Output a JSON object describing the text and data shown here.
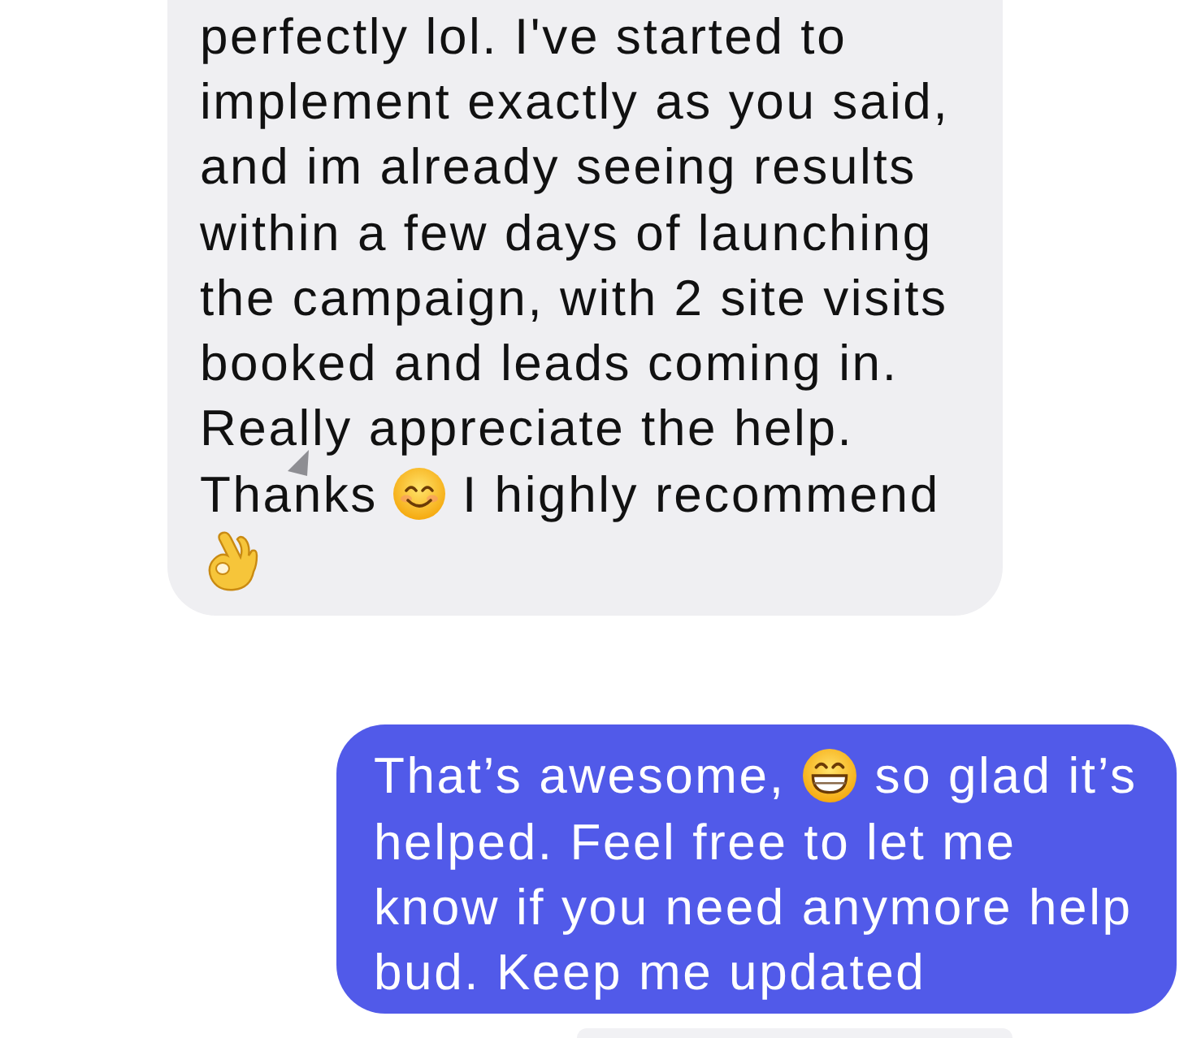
{
  "conversation": {
    "messages": [
      {
        "kind": "received",
        "lines": [
          [
            {
              "kind": "text",
              "text": "perfectly lol. I've started to"
            }
          ],
          [
            {
              "kind": "text",
              "text": "implement exactly as you said,"
            }
          ],
          [
            {
              "kind": "text",
              "text": "and im already seeing results"
            }
          ],
          [
            {
              "kind": "text",
              "text": "within a few days of launching"
            }
          ],
          [
            {
              "kind": "text",
              "text": "the campaign, with 2 site visits"
            }
          ],
          [
            {
              "kind": "text",
              "text": "booked and leads coming in."
            }
          ],
          [
            {
              "kind": "text",
              "text": "Really appreciate the help."
            }
          ],
          [
            {
              "kind": "text",
              "text": "Thanks"
            },
            {
              "kind": "smiling-face"
            },
            {
              "kind": "text",
              "text": "I highly recommend"
            }
          ],
          [
            {
              "kind": "ok-hand"
            }
          ]
        ]
      },
      {
        "kind": "sent",
        "lines": [
          [
            {
              "kind": "text",
              "text": "That’s awesome,"
            },
            {
              "kind": "grinning-face"
            },
            {
              "kind": "text",
              "text": "so glad it’s"
            }
          ],
          [
            {
              "kind": "text",
              "text": "helped. Feel free to let me"
            }
          ],
          [
            {
              "kind": "text",
              "text": "know if you need anymore help"
            }
          ],
          [
            {
              "kind": "text",
              "text": "bud. Keep me updated"
            }
          ]
        ]
      }
    ]
  }
}
